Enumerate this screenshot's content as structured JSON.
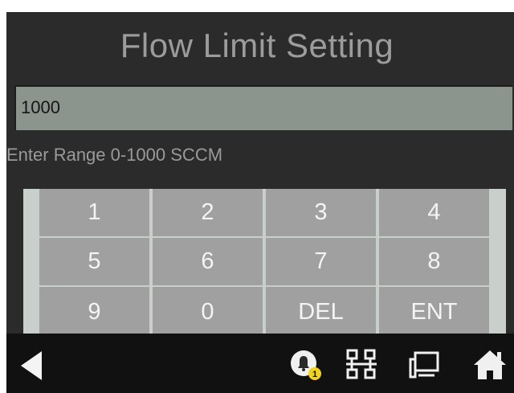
{
  "screen": {
    "title": "Flow Limit Setting",
    "input_value": "1000",
    "hint": "Enter Range 0-1000 SCCM"
  },
  "keypad": {
    "rows": [
      [
        "1",
        "2",
        "3",
        "4"
      ],
      [
        "5",
        "6",
        "7",
        "8"
      ],
      [
        "9",
        "0",
        "DEL",
        "ENT"
      ]
    ]
  },
  "bottom_bar": {
    "icons": [
      "back-arrow-icon",
      "alarm-bell-icon",
      "network-icon",
      "remote-display-icon",
      "home-icon"
    ],
    "alarm_badge": "1"
  },
  "colors": {
    "screen_bg": "#2b2b2b",
    "key_bg": "#a0a0a0",
    "keypad_frame": "#c9cfcb",
    "input_bg": "#8c948e",
    "badge": "#f2d21b"
  }
}
